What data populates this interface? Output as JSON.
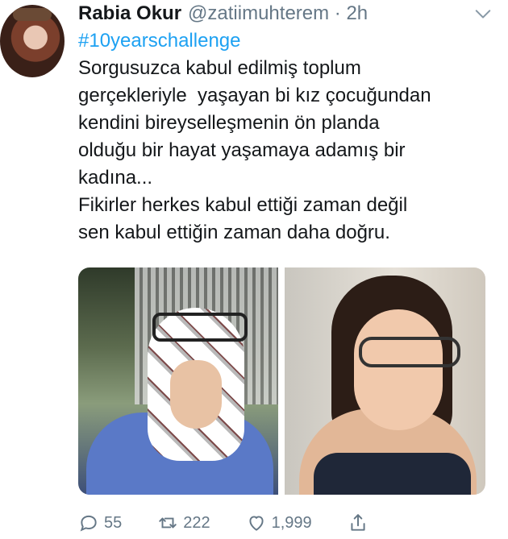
{
  "tweet": {
    "name": "Rabia Okur",
    "handle": "@zatiimuhterem · 2h",
    "hashtag": "#10yearschallenge",
    "lines": [
      "Sorgusuzca kabul edilmiş toplum",
      "gerçekleriyle  yaşayan bi kız çocuğundan",
      "kendini bireyselleşmenin ön planda",
      "olduğu bir hayat yaşamaya adamış bir",
      "kadına...",
      "Fikirler herkes kabul ettiği zaman değil",
      "sen kabul ettiğin zaman daha doğru."
    ],
    "actions": {
      "reply_count": "55",
      "retweet_count": "222",
      "like_count": "1,999"
    }
  },
  "colors": {
    "accent": "#1da1f2",
    "text": "#14171a",
    "muted": "#657786"
  },
  "icons": {
    "menu": "chevron-down-icon",
    "reply": "reply-icon",
    "retweet": "retweet-icon",
    "like": "heart-icon",
    "share": "share-icon"
  }
}
